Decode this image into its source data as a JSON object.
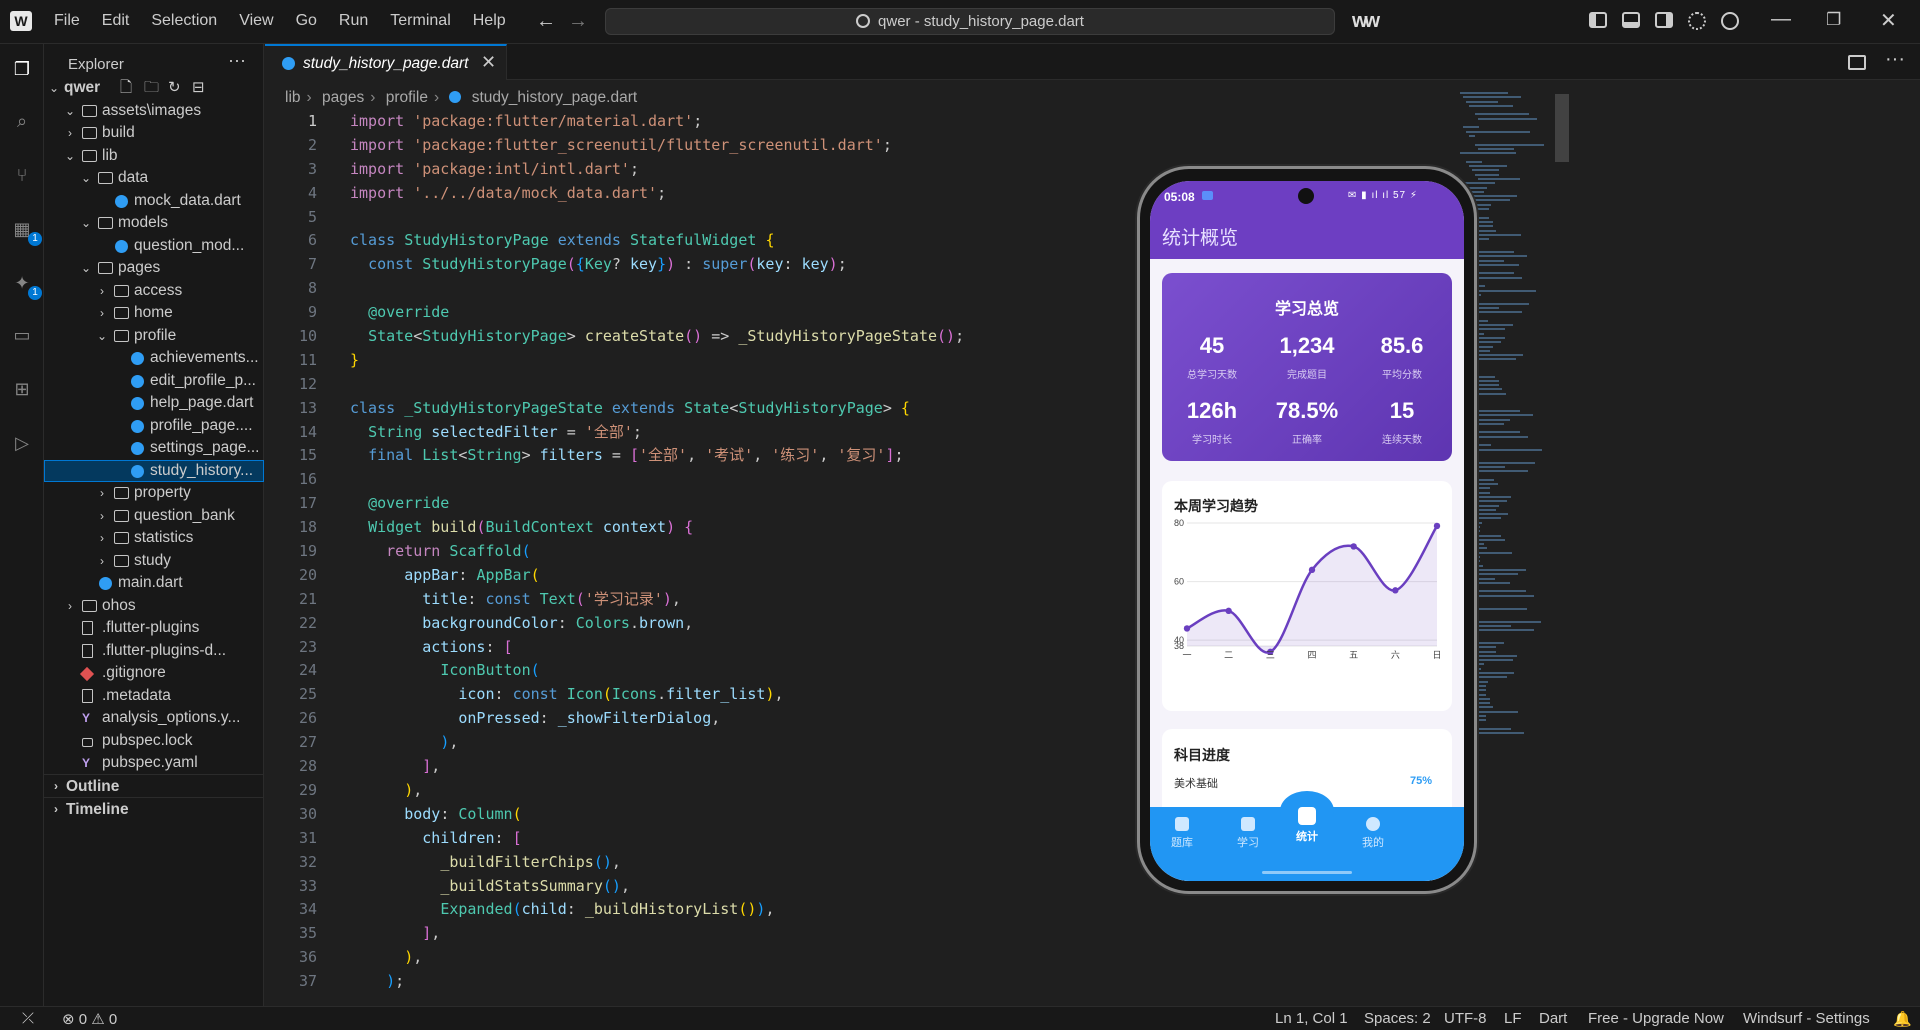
{
  "titlebar": {
    "menu": [
      "File",
      "Edit",
      "Selection",
      "View",
      "Go",
      "Run",
      "Terminal",
      "Help"
    ],
    "command_center": "qwer - study_history_page.dart",
    "back_icon": "arrow-left-icon",
    "forward_icon": "arrow-right-icon",
    "brand_icon": "windsurf-logo",
    "window_controls": [
      "minimize",
      "restore",
      "close"
    ]
  },
  "activitybar": {
    "items": [
      {
        "icon": "explorer-icon",
        "badge": ""
      },
      {
        "icon": "search-icon",
        "badge": ""
      },
      {
        "icon": "source-control-icon",
        "badge": ""
      },
      {
        "icon": "map-icon",
        "badge": "1"
      },
      {
        "icon": "windsurf-ai-icon",
        "badge": "1"
      },
      {
        "icon": "remote-explorer-icon",
        "badge": ""
      },
      {
        "icon": "extensions-icon",
        "badge": ""
      },
      {
        "icon": "run-debug-icon",
        "badge": ""
      }
    ]
  },
  "explorer": {
    "title": "Explorer",
    "more": "···",
    "root": "qwer",
    "rows": [
      {
        "label": "assets\\images",
        "indent": 1,
        "chev": "⌄",
        "icon": "folder-image"
      },
      {
        "label": "build",
        "indent": 1,
        "chev": "›",
        "icon": "folder"
      },
      {
        "label": "lib",
        "indent": 1,
        "chev": "⌄",
        "icon": "folder"
      },
      {
        "label": "data",
        "indent": 2,
        "chev": "⌄",
        "icon": "folder"
      },
      {
        "label": "mock_data.dart",
        "indent": 3,
        "chev": "",
        "icon": "dart"
      },
      {
        "label": "models",
        "indent": 2,
        "chev": "⌄",
        "icon": "folder-image"
      },
      {
        "label": "question_mod...",
        "indent": 3,
        "chev": "",
        "icon": "dart"
      },
      {
        "label": "pages",
        "indent": 2,
        "chev": "⌄",
        "icon": "folder"
      },
      {
        "label": "access",
        "indent": 3,
        "chev": "›",
        "icon": "folder"
      },
      {
        "label": "home",
        "indent": 3,
        "chev": "›",
        "icon": "folder"
      },
      {
        "label": "profile",
        "indent": 3,
        "chev": "⌄",
        "icon": "folder"
      },
      {
        "label": "achievements...",
        "indent": 4,
        "chev": "",
        "icon": "dart"
      },
      {
        "label": "edit_profile_p...",
        "indent": 4,
        "chev": "",
        "icon": "dart"
      },
      {
        "label": "help_page.dart",
        "indent": 4,
        "chev": "",
        "icon": "dart"
      },
      {
        "label": "profile_page....",
        "indent": 4,
        "chev": "",
        "icon": "dart"
      },
      {
        "label": "settings_page...",
        "indent": 4,
        "chev": "",
        "icon": "dart"
      },
      {
        "label": "study_history...",
        "indent": 4,
        "chev": "",
        "icon": "dart",
        "selected": true
      },
      {
        "label": "property",
        "indent": 3,
        "chev": "›",
        "icon": "folder"
      },
      {
        "label": "question_bank",
        "indent": 3,
        "chev": "›",
        "icon": "folder"
      },
      {
        "label": "statistics",
        "indent": 3,
        "chev": "›",
        "icon": "folder"
      },
      {
        "label": "study",
        "indent": 3,
        "chev": "›",
        "icon": "folder"
      },
      {
        "label": "main.dart",
        "indent": 2,
        "chev": "",
        "icon": "dart"
      },
      {
        "label": "ohos",
        "indent": 1,
        "chev": "›",
        "icon": "folder"
      },
      {
        "label": ".flutter-plugins",
        "indent": 1,
        "chev": "",
        "icon": "doc"
      },
      {
        "label": ".flutter-plugins-d...",
        "indent": 1,
        "chev": "",
        "icon": "doc"
      },
      {
        "label": ".gitignore",
        "indent": 1,
        "chev": "",
        "icon": "git"
      },
      {
        "label": ".metadata",
        "indent": 1,
        "chev": "",
        "icon": "doc"
      },
      {
        "label": "analysis_options.y...",
        "indent": 1,
        "chev": "",
        "icon": "yaml"
      },
      {
        "label": "pubspec.lock",
        "indent": 1,
        "chev": "",
        "icon": "lock"
      },
      {
        "label": "pubspec.yaml",
        "indent": 1,
        "chev": "",
        "icon": "yaml"
      }
    ],
    "sections": [
      "Outline",
      "Timeline"
    ]
  },
  "editor": {
    "tab": "study_history_page.dart",
    "breadcrumb": [
      "lib",
      "pages",
      "profile",
      "study_history_page.dart"
    ],
    "current_line": "1"
  },
  "preview": {
    "status_time": "05:08",
    "status_right": "✉ ▮ ıl ıl 57 ⚡",
    "appbar_title": "统计概览",
    "summary_title": "学习总览",
    "stats": [
      {
        "value": "45",
        "label": "总学习天数"
      },
      {
        "value": "1,234",
        "label": "完成题目"
      },
      {
        "value": "85.6",
        "label": "平均分数"
      },
      {
        "value": "126h",
        "label": "学习时长"
      },
      {
        "value": "78.5%",
        "label": "正确率"
      },
      {
        "value": "15",
        "label": "连续天数"
      }
    ],
    "subject_title": "科目进度",
    "subject_name": "美术基础",
    "subject_pct": "75%",
    "nav": [
      {
        "label": "题库",
        "icon": "question-icon",
        "active": false
      },
      {
        "label": "学习",
        "icon": "school-icon",
        "active": false
      },
      {
        "label": "统计",
        "icon": "chart-icon",
        "active": true
      },
      {
        "label": "我的",
        "icon": "person-icon",
        "active": false
      }
    ]
  },
  "chart_data": {
    "type": "line",
    "title": "本周学习趋势",
    "categories": [
      "一",
      "二",
      "三",
      "四",
      "五",
      "六",
      "日"
    ],
    "yticks": [
      "80",
      "60",
      "40",
      "38"
    ],
    "ylim": [
      38,
      80
    ],
    "series": [
      {
        "values": [
          44,
          50,
          36,
          64,
          72,
          57,
          79
        ]
      }
    ],
    "area_fill": true,
    "color": "#6a3fc0"
  },
  "statusbar": {
    "errors": "0",
    "warnings": "0",
    "position": "Ln 1, Col 1",
    "spaces": "Spaces: 2",
    "encoding": "UTF-8",
    "eol": "LF",
    "language": "Dart",
    "upgrade": "Free - Upgrade Now",
    "settings": "Windsurf - Settings"
  }
}
